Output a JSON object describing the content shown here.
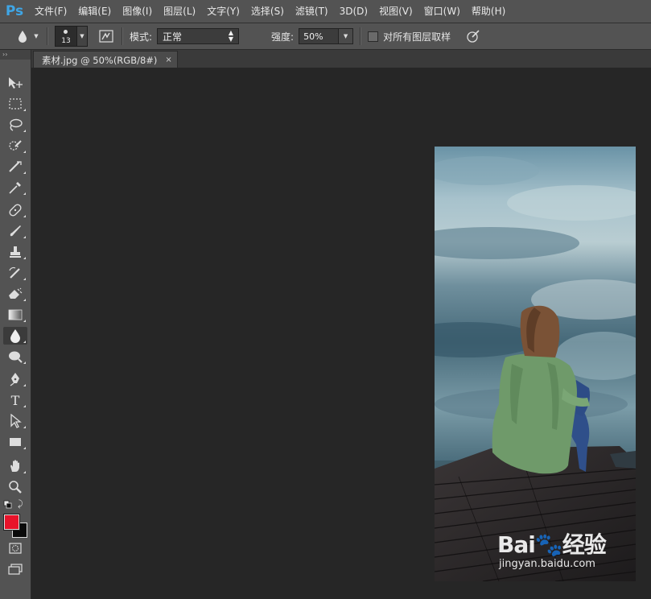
{
  "app": {
    "logo": "Ps"
  },
  "menu": [
    "文件(F)",
    "编辑(E)",
    "图像(I)",
    "图层(L)",
    "文字(Y)",
    "选择(S)",
    "滤镜(T)",
    "3D(D)",
    "视图(V)",
    "窗口(W)",
    "帮助(H)"
  ],
  "options": {
    "brush_size": "13",
    "mode_label": "模式:",
    "mode_value": "正常",
    "strength_label": "强度:",
    "strength_value": "50%",
    "sample_all_label": "对所有图层取样",
    "sample_all_checked": false
  },
  "document": {
    "tab_title": "素材.jpg @ 50%(RGB/8#)",
    "close_glyph": "×"
  },
  "colors": {
    "foreground": "#e8132a",
    "background": "#0a0a0a",
    "accent": "#3fa6e6"
  },
  "tools": [
    "move-icon",
    "marquee-icon",
    "lasso-icon",
    "quick-select-icon",
    "crop-icon",
    "eyedropper-icon",
    "healing-icon",
    "brush-icon",
    "clone-stamp-icon",
    "history-brush-icon",
    "eraser-icon",
    "gradient-icon",
    "blur-icon",
    "dodge-icon",
    "pen-icon",
    "type-icon",
    "path-select-icon",
    "rectangle-icon",
    "hand-icon",
    "zoom-icon"
  ],
  "active_tool": "blur-icon",
  "watermark": {
    "logo": "Bai🐾经验",
    "url": "jingyan.baidu.com"
  }
}
